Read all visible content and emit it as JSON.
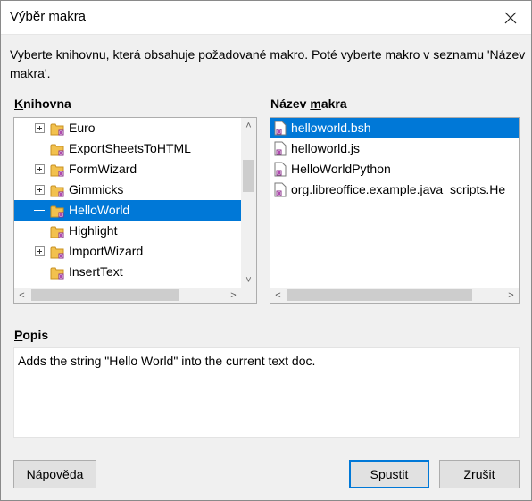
{
  "window": {
    "title": "Výběr makra"
  },
  "description": "Vyberte knihovnu, která obsahuje požadované makro. Poté vyberte makro v seznamu 'Název makra'.",
  "library": {
    "label_underlined": "K",
    "label_rest": "nihovna",
    "items": [
      {
        "label": "Euro",
        "expandable": true,
        "selected": false
      },
      {
        "label": "ExportSheetsToHTML",
        "expandable": false,
        "selected": false
      },
      {
        "label": "FormWizard",
        "expandable": true,
        "selected": false
      },
      {
        "label": "Gimmicks",
        "expandable": true,
        "selected": false
      },
      {
        "label": "HelloWorld",
        "expandable": false,
        "selected": true
      },
      {
        "label": "Highlight",
        "expandable": false,
        "selected": false
      },
      {
        "label": "ImportWizard",
        "expandable": true,
        "selected": false
      },
      {
        "label": "InsertText",
        "expandable": false,
        "selected": false
      }
    ]
  },
  "macros": {
    "label_pre": "Název ",
    "label_underlined": "m",
    "label_post": "akra",
    "items": [
      {
        "label": "helloworld.bsh",
        "selected": true
      },
      {
        "label": "helloworld.js",
        "selected": false
      },
      {
        "label": "HelloWorldPython",
        "selected": false
      },
      {
        "label": "org.libreoffice.example.java_scripts.He",
        "selected": false
      }
    ]
  },
  "popis": {
    "label_underlined": "P",
    "label_rest": "opis",
    "text": "Adds the string \"Hello World\" into the current text doc."
  },
  "buttons": {
    "help": {
      "underlined": "N",
      "rest": "ápověda"
    },
    "run": {
      "underlined": "S",
      "rest": "pustit"
    },
    "cancel": {
      "underlined": "Z",
      "rest": "rušit"
    }
  }
}
